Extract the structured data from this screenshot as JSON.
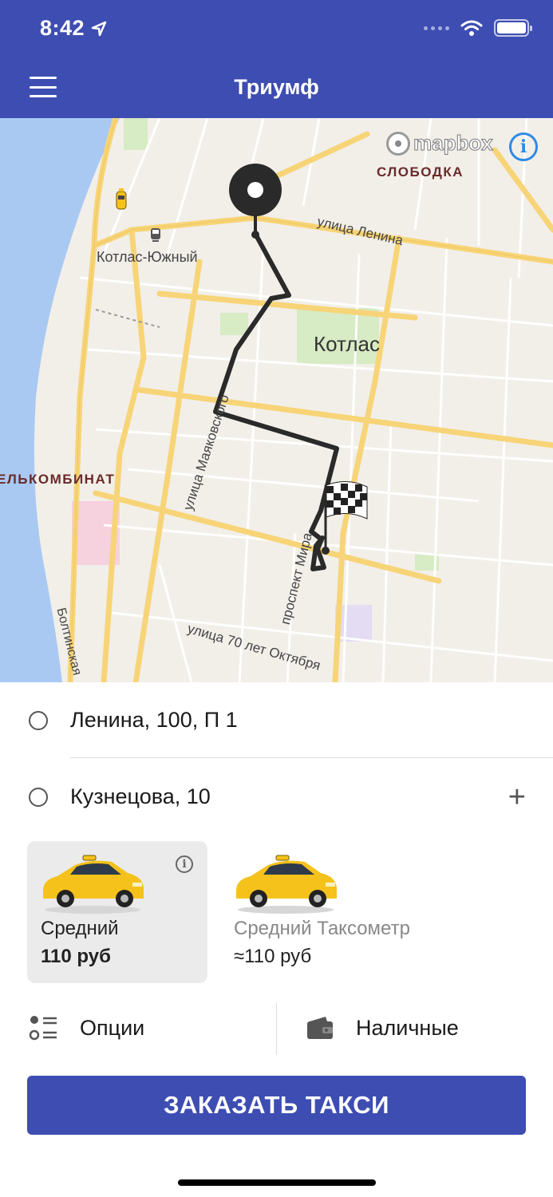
{
  "status_bar": {
    "time": "8:42",
    "location_icon": "location-arrow-icon",
    "signal_icon": "signal-dots-icon",
    "wifi_icon": "wifi-icon",
    "battery_icon": "battery-icon",
    "battery_level": 1.0
  },
  "header": {
    "title": "Триумф",
    "menu_icon": "hamburger-menu-icon"
  },
  "map": {
    "labels": {
      "kotlas_south": "Котлас-Южный",
      "kotlas": "Котлас",
      "slobodka": "СЛОБОДКА",
      "combine": "ЕЛЬКОМБИНАТ",
      "lenina_street": "улица Ленина",
      "mayakovskogo": "улица Маяковского",
      "prospect": "проспект Мира",
      "october": "улица 70 лет Октября",
      "boltinskaya": "Болтинская"
    },
    "attribution": "mapbox",
    "info_icon": "info-icon",
    "start_marker": "pickup-pin-icon",
    "finish_marker": "checkered-flag-icon",
    "taxi_marker": "taxi-car-icon"
  },
  "route": {
    "from": "Ленина, 100, П 1",
    "to": "Кузнецова, 10",
    "add_stop_icon": "plus-icon"
  },
  "tariffs": [
    {
      "name": "Средний",
      "price": "110 руб",
      "selected": true,
      "info_icon": "info-icon"
    },
    {
      "name": "Средний Таксометр",
      "price": "≈110 руб",
      "selected": false
    }
  ],
  "options": {
    "label": "Опции",
    "icon": "options-list-icon"
  },
  "payment": {
    "label": "Наличные",
    "icon": "wallet-icon"
  },
  "order_button": "ЗАКАЗАТЬ ТАКСИ",
  "colors": {
    "brand": "#3e4db2",
    "map_bg": "#f2efe9",
    "river": "#a9c9f2",
    "road": "#f7d477",
    "park": "#d7ebc4"
  }
}
